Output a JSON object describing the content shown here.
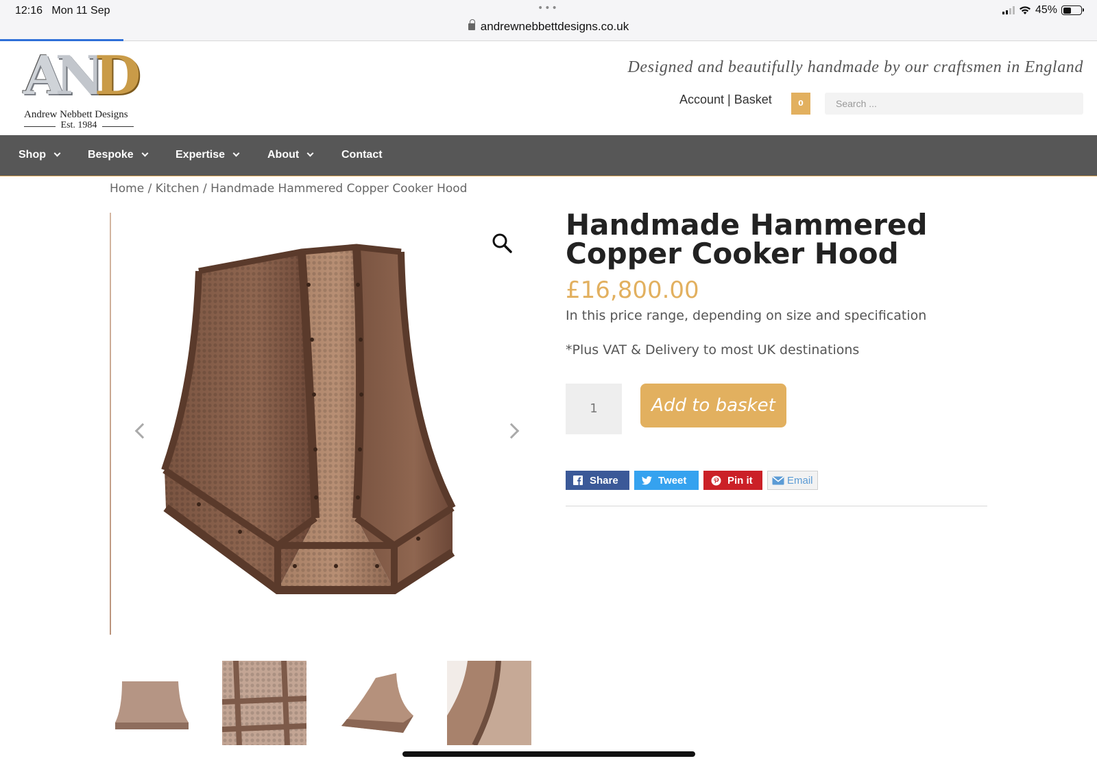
{
  "status_bar": {
    "time": "12:16",
    "date": "Mon 11 Sep",
    "url": "andrewnebbettdesigns.co.uk",
    "battery": "45%",
    "battery_level": 0.45
  },
  "brand": {
    "logo_letters": "AND",
    "name": "Andrew Nebbett Designs",
    "established": "Est. 1984",
    "tagline": "Designed and beautifully handmade by our craftsmen in England",
    "accent_color": "#e2b05f",
    "nav_color": "#575757"
  },
  "header": {
    "account_basket": "Account | Basket",
    "basket_count": "0",
    "search_placeholder": "Search ..."
  },
  "nav": {
    "items": [
      {
        "label": "Shop",
        "has_menu": true
      },
      {
        "label": "Bespoke",
        "has_menu": true
      },
      {
        "label": "Expertise",
        "has_menu": true
      },
      {
        "label": "About",
        "has_menu": true
      },
      {
        "label": "Contact",
        "has_menu": false
      }
    ]
  },
  "breadcrumb": "Home / Kitchen / Handmade Hammered Copper Cooker Hood",
  "product": {
    "title": "Handmade Hammered Copper Cooker Hood",
    "price": "£16,800.00",
    "price_note": "In this price range, depending on size and specification",
    "vat_note": "*Plus VAT & Delivery to most UK destinations",
    "quantity": "1",
    "add_to_basket": "Add to basket"
  },
  "share": {
    "facebook": "Share",
    "twitter": "Tweet",
    "pinterest": "Pin it",
    "email": "Email"
  },
  "icons": [
    "lock-icon",
    "signal-icon",
    "wifi-icon",
    "battery-icon",
    "zoom-icon",
    "chevron-left-icon",
    "chevron-right-icon",
    "facebook-icon",
    "twitter-icon",
    "pinterest-icon",
    "mail-icon"
  ]
}
